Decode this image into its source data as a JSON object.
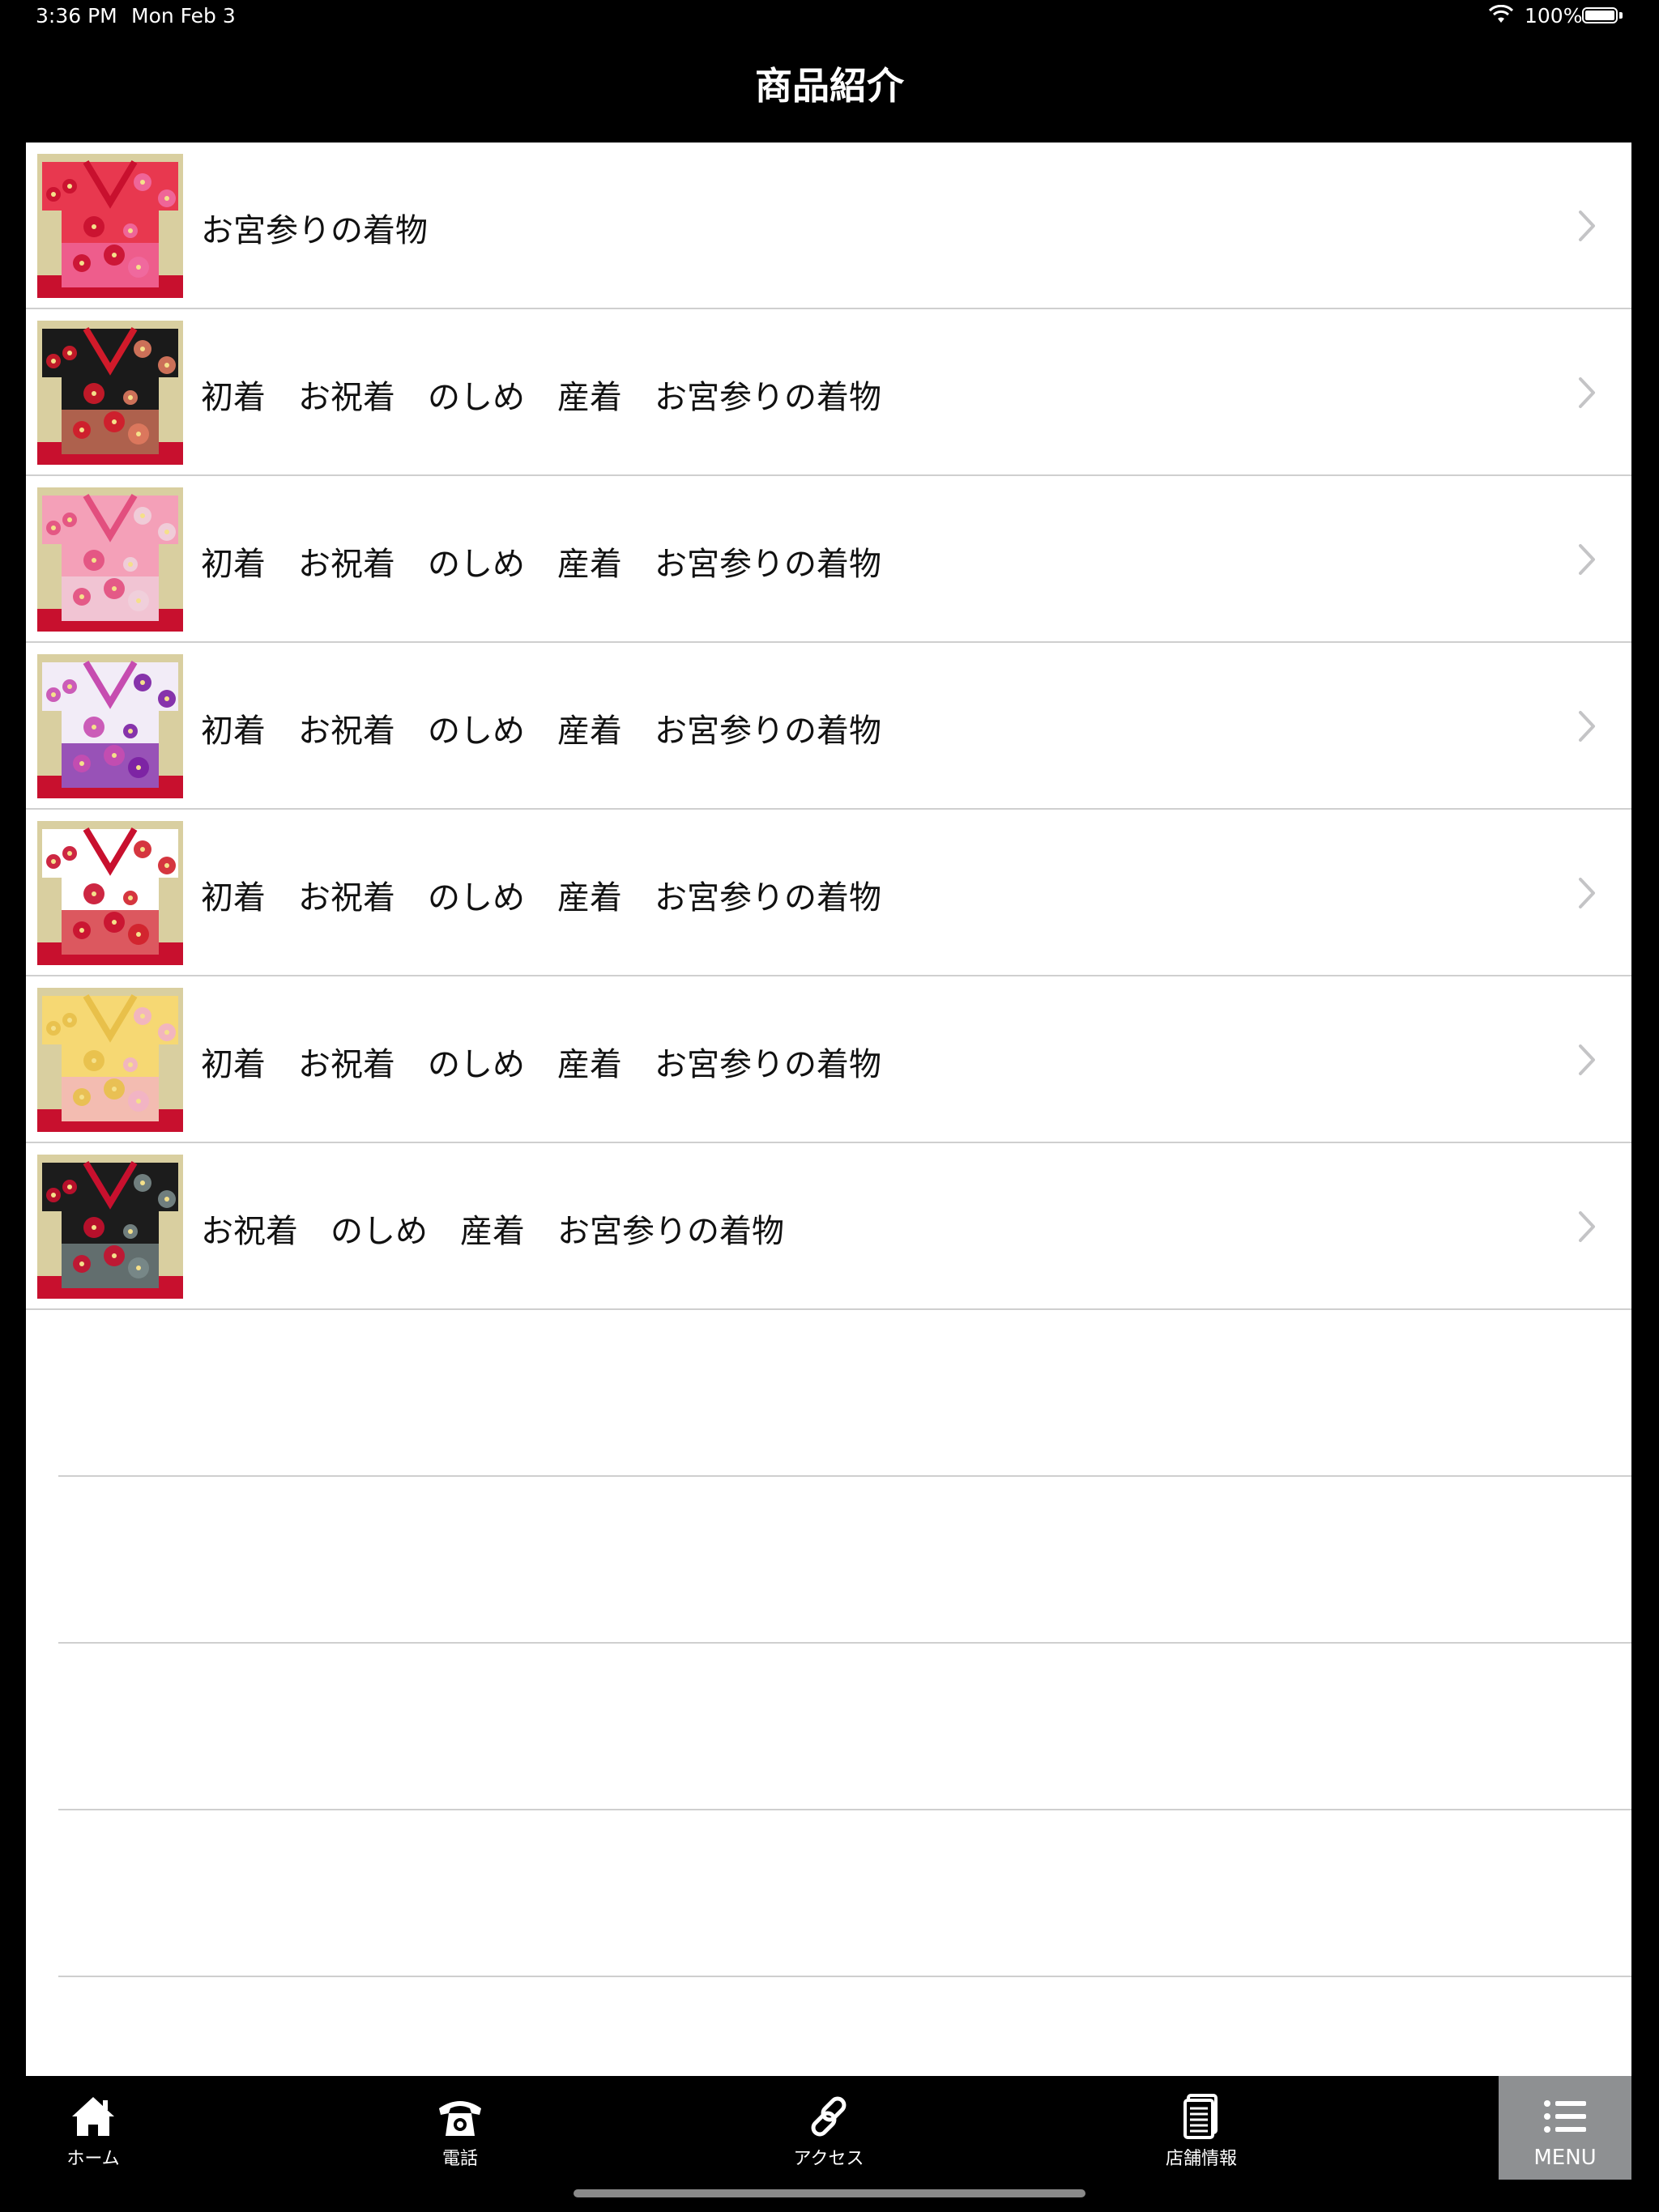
{
  "status_bar": {
    "time": "3:36 PM",
    "date": "Mon Feb 3",
    "battery": "100%"
  },
  "nav": {
    "title": "商品紹介"
  },
  "products": [
    {
      "label": "お宮参りの着物",
      "thumb_colors": [
        "#e8384f",
        "#f06aa0",
        "#c8102e"
      ]
    },
    {
      "label": "初着　お祝着　のしめ　産着　お宮参りの着物",
      "thumb_colors": [
        "#1a1a1a",
        "#e07a5f",
        "#d11a2a"
      ]
    },
    {
      "label": "初着　お祝着　のしめ　産着　お宮参りの着物",
      "thumb_colors": [
        "#f4a0b8",
        "#f0d0dc",
        "#e24f7e"
      ]
    },
    {
      "label": "初着　お祝着　のしめ　産着　お宮参りの着物",
      "thumb_colors": [
        "#f2ecf7",
        "#7a1fa2",
        "#c64cb0"
      ]
    },
    {
      "label": "初着　お祝着　のしめ　産着　お宮参りの着物",
      "thumb_colors": [
        "#ffffff",
        "#d0202a",
        "#c8102e"
      ]
    },
    {
      "label": "初着　お祝着　のしめ　産着　お宮参りの着物",
      "thumb_colors": [
        "#f6d873",
        "#f2b3c6",
        "#e8c04a"
      ]
    },
    {
      "label": "お祝着　のしめ　産着　お宮参りの着物",
      "thumb_colors": [
        "#1c1c1c",
        "#7a8a8a",
        "#c8102e"
      ]
    }
  ],
  "tabs": [
    {
      "label": "ホーム",
      "icon": "home-icon"
    },
    {
      "label": "電話",
      "icon": "phone-icon"
    },
    {
      "label": "アクセス",
      "icon": "link-icon"
    },
    {
      "label": "店舗情報",
      "icon": "document-icon"
    },
    {
      "label": "MENU",
      "icon": "list-icon"
    }
  ],
  "colors": {
    "background": "#000000",
    "content": "#ffffff",
    "separator": "#cfcfcf",
    "menu_tab_bg": "#8e9092"
  }
}
